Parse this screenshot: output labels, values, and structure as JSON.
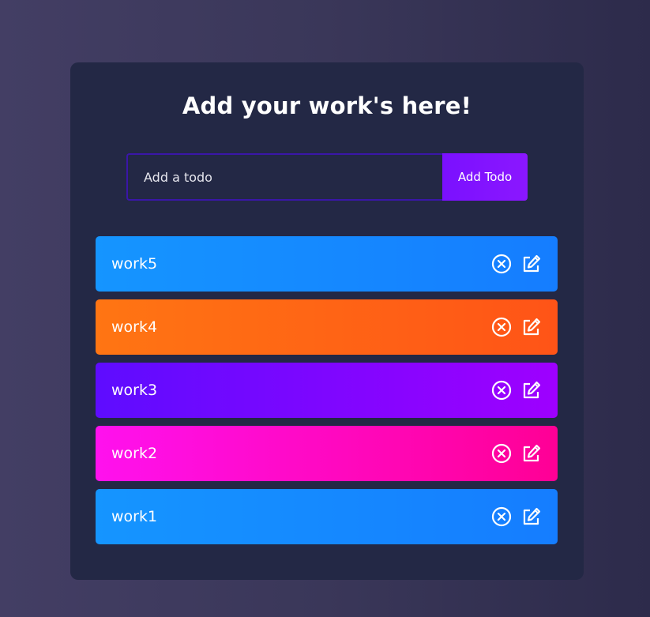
{
  "header": {
    "title": "Add your work's here!"
  },
  "form": {
    "input_placeholder": "Add a todo",
    "input_value": "",
    "add_button_label": "Add Todo"
  },
  "todos": [
    {
      "text": "work5",
      "color": "#1595ff"
    },
    {
      "text": "work4",
      "color": "#ff6514"
    },
    {
      "text": "work3",
      "color": "#7a08ff"
    },
    {
      "text": "work2",
      "color": "#ff0cc8"
    },
    {
      "text": "work1",
      "color": "#1595ff"
    }
  ],
  "icons": {
    "delete": "close-circle-icon",
    "edit": "edit-icon"
  },
  "theme": {
    "background": "#3a3759",
    "card": "#232845",
    "accent": "#8b17ff"
  }
}
